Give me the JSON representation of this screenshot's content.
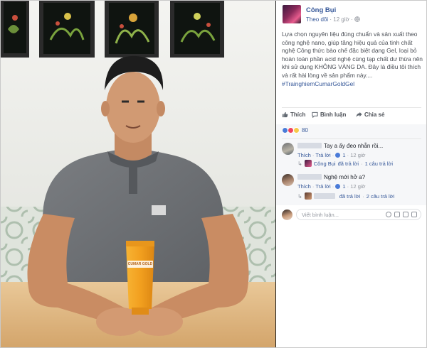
{
  "post": {
    "author": "Công Bụi",
    "follow_label": "Theo dõi",
    "time": "12 giờ",
    "text": "Lựa chọn nguyên liệu đúng chuẩn và sản xuất theo công nghệ nano, giúp tăng hiệu quả của tinh chất nghệ Công thức bào chế đặc biệt dạng Gel, loại bỏ hoàn toàn phần acid nghệ cùng tạp chất dư thừa nên khi sử dụng KHÔNG VÀNG DA. Đây là điều tôi thích và rất hài lòng về sản phẩm này....",
    "hashtag": "#TrainghiemCumarGoldGel"
  },
  "actions": {
    "like": "Thích",
    "comment": "Bình luận",
    "share": "Chia sẻ"
  },
  "reactions": {
    "count": "80",
    "types": [
      "like-icon",
      "love-icon",
      "haha-icon"
    ]
  },
  "comments": [
    {
      "text": "Tay a ấy đeo nhẫn rồi...",
      "like_label": "Thích",
      "reply_label": "Trả lời",
      "likes": "1",
      "time": "12 giờ",
      "reply_summary_author": "Công Bụi",
      "reply_summary_text": "đã trả lời",
      "reply_summary_count": "1 câu trả lời"
    },
    {
      "text": "Nghệ mới hở a?",
      "like_label": "Thích",
      "reply_label": "Trả lời",
      "likes": "1",
      "time": "12 giờ",
      "reply_summary_text": "đã trả lời",
      "reply_summary_count": "2 câu trả lời"
    }
  ],
  "composer": {
    "placeholder": "Viết bình luận..."
  },
  "product": {
    "tube_label": "CUMAR GOLD"
  },
  "colors": {
    "link_blue": "#365899",
    "text_gray": "#90949c",
    "photo_wall": "#f1f2ee",
    "tube_orange": "#f2a01f"
  }
}
